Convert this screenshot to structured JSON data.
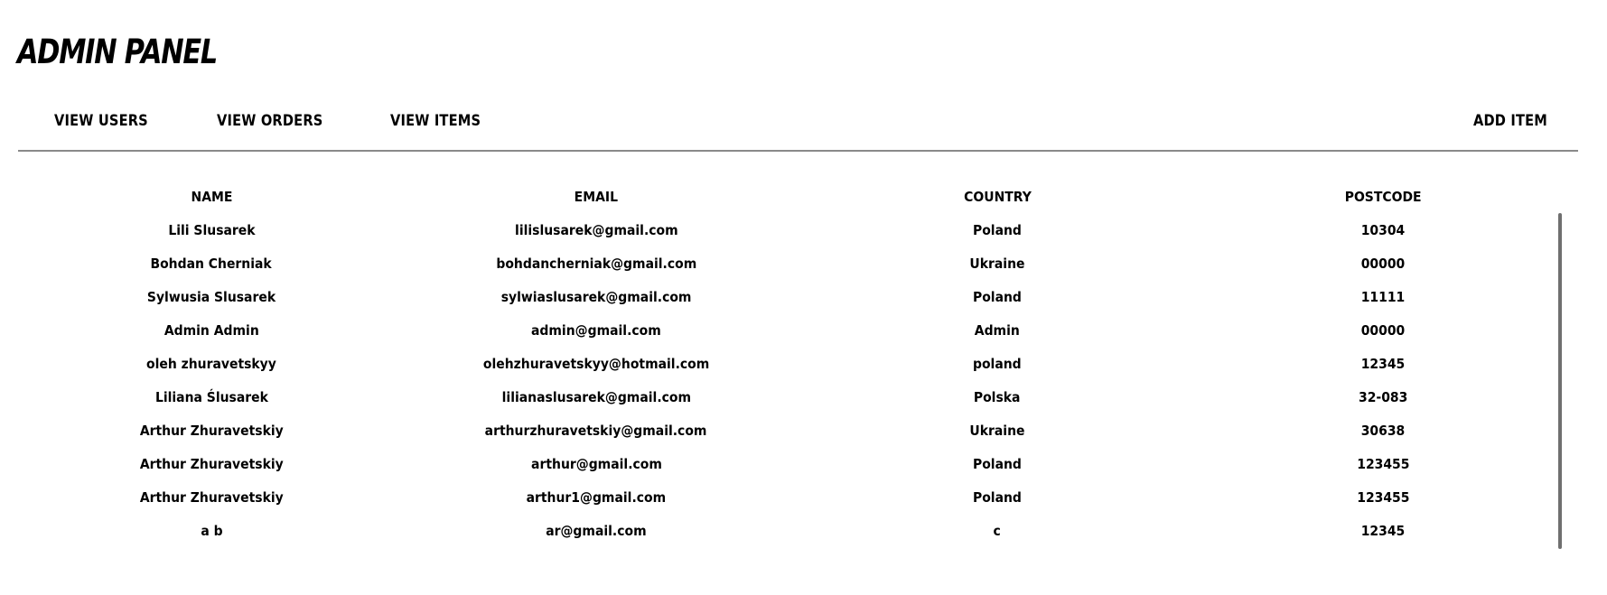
{
  "header": {
    "title": "ADMIN PANEL"
  },
  "nav": {
    "view_users": "VIEW USERS",
    "view_orders": "VIEW ORDERS",
    "view_items": "VIEW ITEMS",
    "add_item": "ADD ITEM"
  },
  "table": {
    "columns": [
      "NAME",
      "EMAIL",
      "COUNTRY",
      "POSTCODE"
    ],
    "rows": [
      [
        "Lili Slusarek",
        "lilislusarek@gmail.com",
        "Poland",
        "10304"
      ],
      [
        "Bohdan Cherniak",
        "bohdancherniak@gmail.com",
        "Ukraine",
        "00000"
      ],
      [
        "Sylwusia Slusarek",
        "sylwiaslusarek@gmail.com",
        "Poland",
        "11111"
      ],
      [
        "Admin Admin",
        "admin@gmail.com",
        "Admin",
        "00000"
      ],
      [
        "oleh zhuravetskyy",
        "olehzhuravetskyy@hotmail.com",
        "poland",
        "12345"
      ],
      [
        "Liliana Ślusarek",
        "lilianaslusarek@gmail.com",
        "Polska",
        "32-083"
      ],
      [
        "Arthur Zhuravetskiy",
        "arthurzhuravetskiy@gmail.com",
        "Ukraine",
        "30638"
      ],
      [
        "Arthur Zhuravetskiy",
        "arthur@gmail.com",
        "Poland",
        "123455"
      ],
      [
        "Arthur Zhuravetskiy",
        "arthur1@gmail.com",
        "Poland",
        "123455"
      ],
      [
        "a b",
        "ar@gmail.com",
        "c",
        "12345"
      ]
    ]
  },
  "colors": {
    "text": "#000000",
    "background": "#ffffff",
    "divider": "#8a8a8a",
    "scrollbar": "#6f6f6f"
  }
}
